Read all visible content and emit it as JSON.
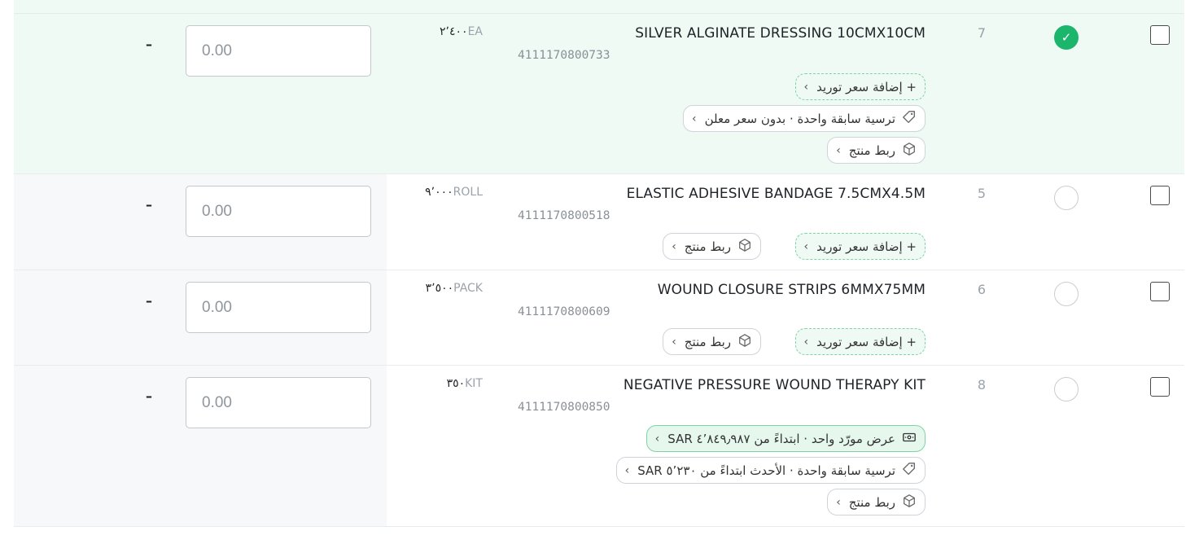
{
  "rows": [
    {
      "selected": true,
      "index": "7",
      "name": "SILVER ALGINATE DRESSING 10CMX10CM",
      "code": "4111170800733",
      "qty": "٢٬٤٠٠",
      "unit": "EA",
      "pills": [
        {
          "label": "+ إضافة سعر توريد",
          "icon": "",
          "style": "dashed"
        },
        {
          "label": "ترسية سابقة واحدة · بدون سعر معلن",
          "icon": "tag-icon",
          "style": "plain"
        },
        {
          "label": "ربط منتج",
          "icon": "box-icon",
          "style": "plain"
        }
      ],
      "price_placeholder": "0.00",
      "dash": "–"
    },
    {
      "selected": false,
      "index": "5",
      "name": "ELASTIC ADHESIVE BANDAGE 7.5CMX4.5M",
      "code": "4111170800518",
      "qty": "٩٬٠٠٠",
      "unit": "ROLL",
      "pills": [
        {
          "label": "+ إضافة سعر توريد",
          "icon": "",
          "style": "dashed"
        },
        {
          "label": "ربط منتج",
          "icon": "box-icon",
          "style": "plain"
        }
      ],
      "price_placeholder": "0.00",
      "dash": "–"
    },
    {
      "selected": false,
      "index": "6",
      "name": "WOUND CLOSURE STRIPS 6MMX75MM",
      "code": "4111170800609",
      "qty": "٣٬٥٠٠",
      "unit": "PACK",
      "pills": [
        {
          "label": "+ إضافة سعر توريد",
          "icon": "",
          "style": "dashed"
        },
        {
          "label": "ربط منتج",
          "icon": "box-icon",
          "style": "plain"
        }
      ],
      "price_placeholder": "0.00",
      "dash": "–"
    },
    {
      "selected": false,
      "index": "8",
      "name": "NEGATIVE PRESSURE WOUND THERAPY KIT",
      "code": "4111170800850",
      "qty": "٣٥٠",
      "unit": "KIT",
      "pills": [
        {
          "label": "عرض مورّد واحد · ابتداءً من ٤٬٨٤٩٫٩٨٧ SAR",
          "icon": "cash-icon",
          "style": "green"
        },
        {
          "label": "ترسية سابقة واحدة · الأحدث ابتداءً من ٥٬٢٣٠ SAR",
          "icon": "tag-icon",
          "style": "plain"
        },
        {
          "label": "ربط منتج",
          "icon": "box-icon",
          "style": "plain"
        }
      ],
      "price_placeholder": "0.00",
      "dash": "–"
    }
  ],
  "pill_chevron": "›"
}
